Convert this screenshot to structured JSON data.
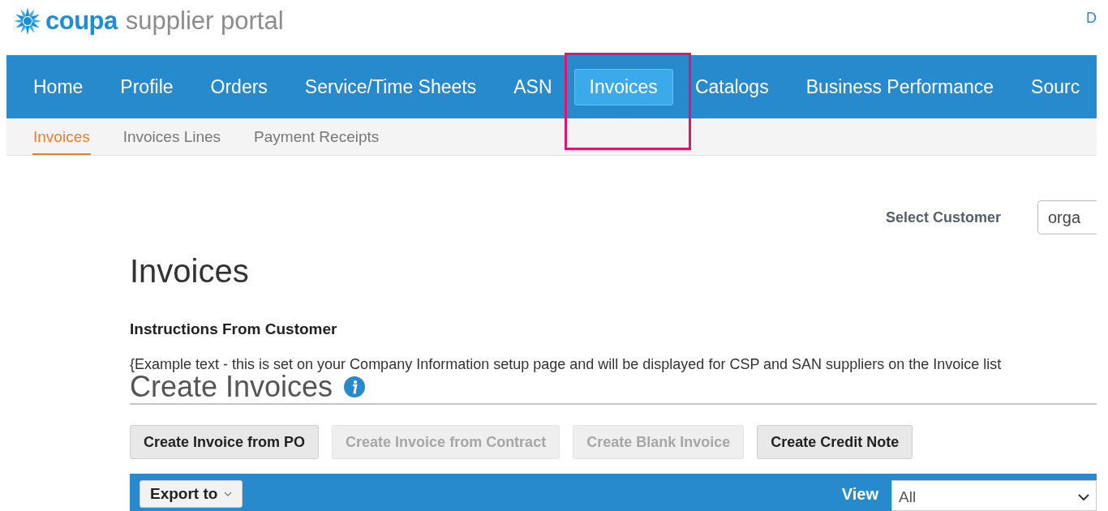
{
  "header": {
    "logo_brand": "coupa",
    "logo_product": "supplier portal",
    "corner_link": "D"
  },
  "nav": [
    {
      "label": "Home",
      "selected": false
    },
    {
      "label": "Profile",
      "selected": false
    },
    {
      "label": "Orders",
      "selected": false
    },
    {
      "label": "Service/Time Sheets",
      "selected": false
    },
    {
      "label": "ASN",
      "selected": false
    },
    {
      "label": "Invoices",
      "selected": true
    },
    {
      "label": "Catalogs",
      "selected": false
    },
    {
      "label": "Business Performance",
      "selected": false
    },
    {
      "label": "Sourc",
      "selected": false
    }
  ],
  "subnav": [
    {
      "label": "Invoices",
      "selected": true
    },
    {
      "label": "Invoices Lines",
      "selected": false
    },
    {
      "label": "Payment Receipts",
      "selected": false
    }
  ],
  "customer": {
    "label": "Select Customer",
    "value": "orga"
  },
  "title": "Invoices",
  "instructions": {
    "heading": "Instructions From Customer",
    "text": "{Example text - this is set on your Company Information setup page and will be displayed for CSP and SAN suppliers on the Invoice list"
  },
  "create": {
    "heading": "Create Invoices",
    "buttons": [
      {
        "label": "Create Invoice from PO",
        "disabled": false
      },
      {
        "label": "Create Invoice from Contract",
        "disabled": true
      },
      {
        "label": "Create Blank Invoice",
        "disabled": true
      },
      {
        "label": "Create Credit Note",
        "disabled": false
      }
    ]
  },
  "toolbar": {
    "export": "Export to",
    "view_label": "View",
    "view_value": "All"
  }
}
